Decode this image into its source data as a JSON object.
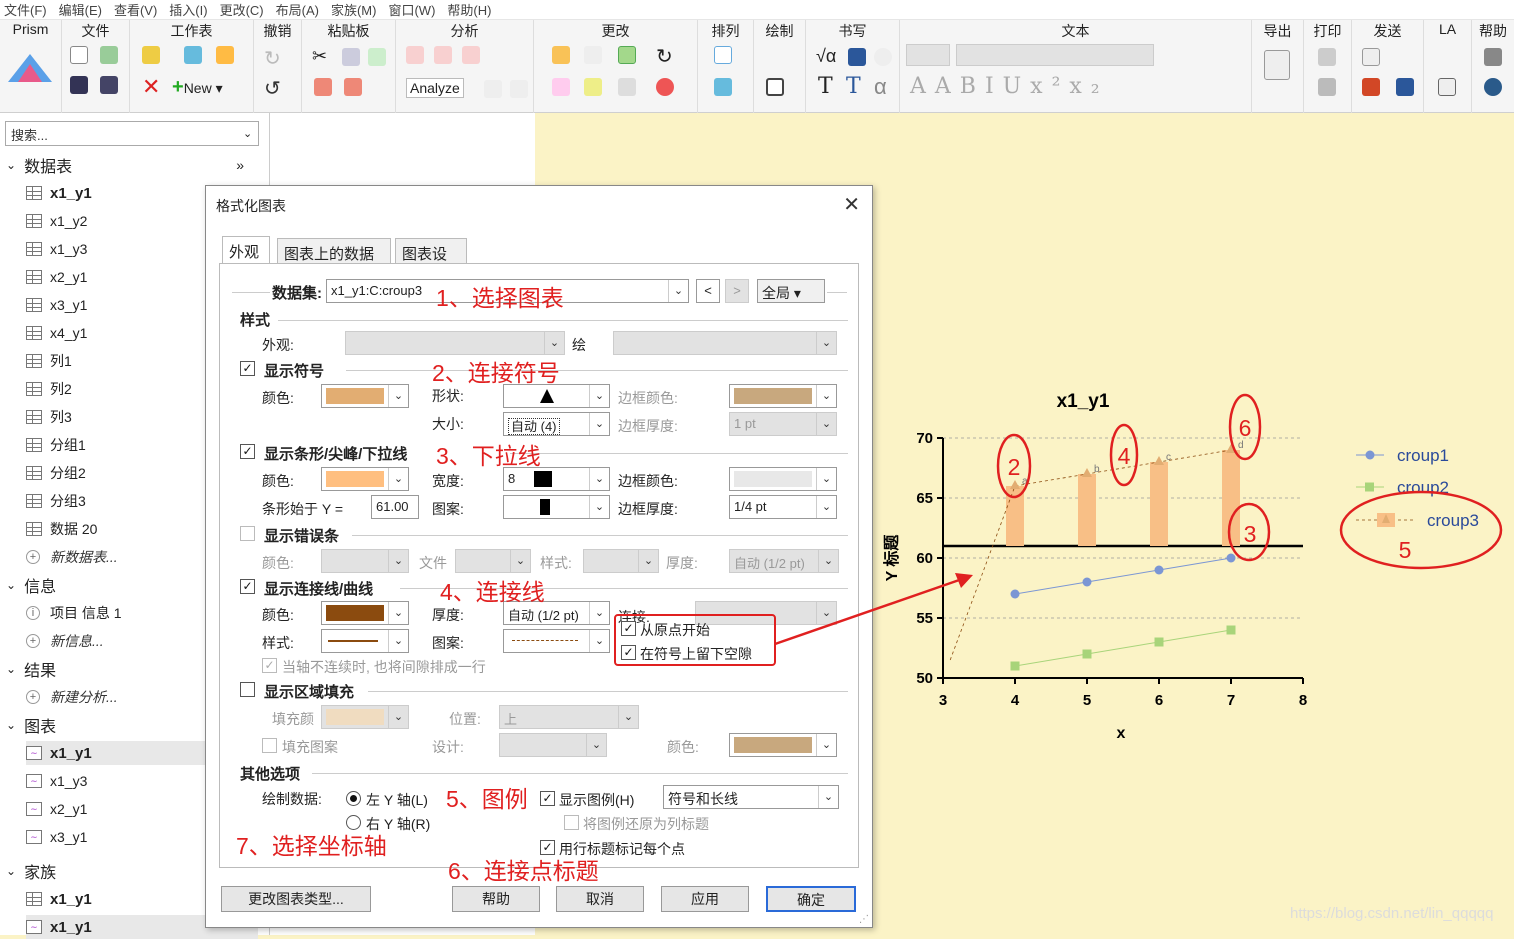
{
  "menu": [
    "文件(F)",
    "编辑(E)",
    "查看(V)",
    "插入(I)",
    "更改(C)",
    "布局(A)",
    "家族(M)",
    "窗口(W)",
    "帮助(H)"
  ],
  "ribbon": {
    "groups": [
      "Prism",
      "文件",
      "工作表",
      "撤销",
      "粘贴板",
      "分析",
      "更改",
      "排列",
      "绘制",
      "书写",
      "文本",
      "导出",
      "打印",
      "发送",
      "LA",
      "帮助"
    ],
    "new_label": "New",
    "analyze_label": "Analyze"
  },
  "search": {
    "placeholder": "搜索..."
  },
  "nav": {
    "data_header": "数据表",
    "data_items": [
      "x1_y1",
      "x1_y2",
      "x1_y3",
      "x2_y1",
      "x3_y1",
      "x4_y1",
      "列1",
      "列2",
      "列3",
      "分组1",
      "分组2",
      "分组3",
      "数据 20"
    ],
    "new_data": "新数据表...",
    "info_header": "信息",
    "info_items": [
      "项目 信息 1"
    ],
    "new_info": "新信息...",
    "result_header": "结果",
    "new_result": "新建分析...",
    "graph_header": "图表",
    "graph_items": [
      "x1_y1",
      "x1_y3",
      "x2_y1",
      "x3_y1"
    ],
    "family_header": "家族",
    "family_items": [
      "x1_y1",
      "x1_y1"
    ]
  },
  "dialog": {
    "title": "格式化图表",
    "tabs": [
      "外观",
      "图表上的数据集",
      "图表设置"
    ],
    "dataset_label": "数据集:",
    "dataset_value": "x1_y1:C:croup3",
    "global_label": "全局",
    "style_header": "样式",
    "appearance_label": "外观:",
    "draw_label": "绘",
    "show_symbols": "显示符号",
    "color_label": "颜色:",
    "shape_label": "形状:",
    "size_label": "大小:",
    "size_value": "自动 (4)",
    "border_color_label": "边框颜色:",
    "border_thick_label": "边框厚度:",
    "border_thick_value": "1 pt",
    "show_bars": "显示条形/尖峰/下拉线",
    "width_label": "宽度:",
    "width_value": "8",
    "bar_start_label": "条形始于 Y =",
    "bar_start_value": "61.00",
    "pattern_label": "图案:",
    "bar_border_thick_value": "1/4 pt",
    "show_errors": "显示错误条",
    "file_label": "文件",
    "style_label": "样式:",
    "thick_label": "厚度:",
    "error_thick_value": "自动 (1/2 pt)",
    "show_lines": "显示连接线/曲线",
    "line_thick_value": "自动 (1/2 pt)",
    "connect_label": "连接:",
    "from_origin": "从原点开始",
    "leave_gap": "在符号上留下空隙",
    "axis_gap_text": "当轴不连续时, 也将间隙排成一行",
    "show_fill": "显示区域填充",
    "fill_color_label": "填充颜",
    "position_label": "位置:",
    "position_value": "上",
    "fill_pattern_label": "填充图案",
    "design_label": "设计:",
    "other_header": "其他选项",
    "plot_data_label": "绘制数据:",
    "left_axis": "左 Y 轴(L)",
    "right_axis": "右 Y 轴(R)",
    "show_legend": "显示图例(H)",
    "legend_value": "符号和长线",
    "legend_restore": "将图例还原为列标题",
    "row_labels": "用行标题标记每个点",
    "btn_change": "更改图表类型...",
    "btn_help": "帮助",
    "btn_cancel": "取消",
    "btn_apply": "应用",
    "btn_ok": "确定"
  },
  "annotations": [
    "1、选择图表",
    "2、连接符号",
    "3、下拉线",
    "4、连接线",
    "5、图例",
    "6、连接点标题",
    "7、选择坐标轴"
  ],
  "callout_numbers": [
    "2",
    "4",
    "6",
    "3",
    "5"
  ],
  "chart_data": {
    "type": "bar+line",
    "title": "x1_y1",
    "xlabel": "x",
    "ylabel": "Y 标题",
    "xlim": [
      3,
      8
    ],
    "ylim": [
      50,
      70
    ],
    "xticks": [
      3,
      4,
      5,
      6,
      7,
      8
    ],
    "yticks": [
      50,
      55,
      60,
      65,
      70
    ],
    "bar_baseline": 61,
    "series": [
      {
        "name": "croup1",
        "x": [
          4,
          5,
          6,
          7
        ],
        "y": [
          57,
          58,
          59,
          60
        ],
        "color": "#7b96d4",
        "marker": "circle"
      },
      {
        "name": "croup2",
        "x": [
          4,
          5,
          6,
          7
        ],
        "y": [
          51,
          52,
          53,
          54
        ],
        "color": "#a8d47a",
        "marker": "square"
      },
      {
        "name": "croup3",
        "x": [
          4,
          5,
          6,
          7
        ],
        "y": [
          66,
          67,
          68,
          69
        ],
        "color": "#f8bf86",
        "marker": "triangle",
        "point_labels": [
          "a",
          "b",
          "c",
          "d"
        ]
      }
    ],
    "legend_position": "right"
  },
  "watermark": "https://blog.csdn.net/lin_qqqqq"
}
